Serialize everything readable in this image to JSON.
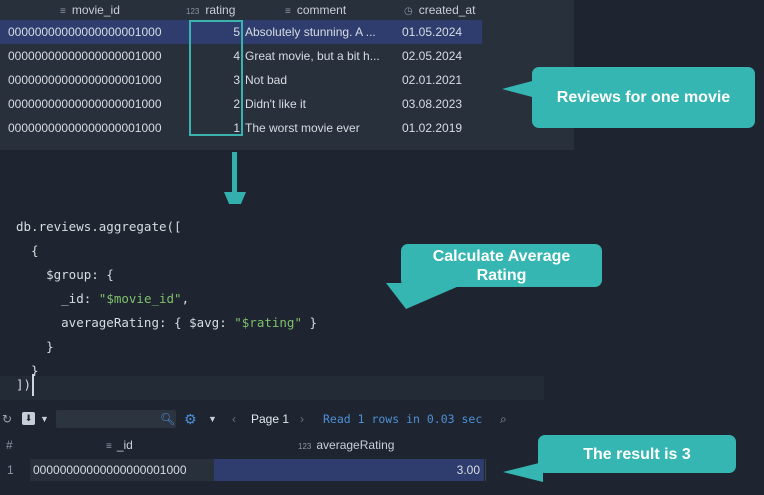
{
  "top_grid": {
    "columns": [
      {
        "label": "movie_id",
        "icon": "text-lines-icon"
      },
      {
        "label": "rating",
        "icon": "numeric-123-icon"
      },
      {
        "label": "comment",
        "icon": "text-lines-icon"
      },
      {
        "label": "created_at",
        "icon": "clock-icon"
      }
    ],
    "rows": [
      {
        "movie_id": "00000000000000000001000",
        "rating": "5",
        "comment": "Absolutely stunning. A ...",
        "created_at": "01.05.2024"
      },
      {
        "movie_id": "00000000000000000001000",
        "rating": "4",
        "comment": "Great movie, but a bit h...",
        "created_at": "02.05.2024"
      },
      {
        "movie_id": "00000000000000000001000",
        "rating": "3",
        "comment": "Not bad",
        "created_at": "02.01.2021"
      },
      {
        "movie_id": "00000000000000000001000",
        "rating": "2",
        "comment": "Didn't like it",
        "created_at": "03.08.2023"
      },
      {
        "movie_id": "00000000000000000001000",
        "rating": "1",
        "comment": "The worst movie ever",
        "created_at": "01.02.2019"
      }
    ]
  },
  "code": {
    "l1": "db.reviews.aggregate([",
    "l2": "  {",
    "l3": "    $group: {",
    "l4_pre": "      _id: ",
    "l4_str": "\"$movie_id\"",
    "l4_post": ",",
    "l5_pre": "      averageRating: { $avg: ",
    "l5_str": "\"$rating\"",
    "l5_post": " }",
    "l6": "    }",
    "l7": "  }",
    "l8": "])"
  },
  "toolbar": {
    "page_label": "Page 1",
    "status": "Read 1 rows in 0.03 sec"
  },
  "result_grid": {
    "index_header": "#",
    "columns": [
      {
        "label": "_id",
        "icon": "text-lines-icon"
      },
      {
        "label": "averageRating",
        "icon": "numeric-123-icon"
      }
    ],
    "rows": [
      {
        "index": "1",
        "_id": "00000000000000000001000",
        "averageRating": "3.00"
      }
    ]
  },
  "callouts": {
    "reviews": "Reviews for one movie",
    "average_line1": "Calculate Average",
    "average_line2": "Rating",
    "result": "The result is 3"
  },
  "colors": {
    "accent": "#36b6b2",
    "selection": "#2f3d6e",
    "string": "#7fbf6a"
  }
}
